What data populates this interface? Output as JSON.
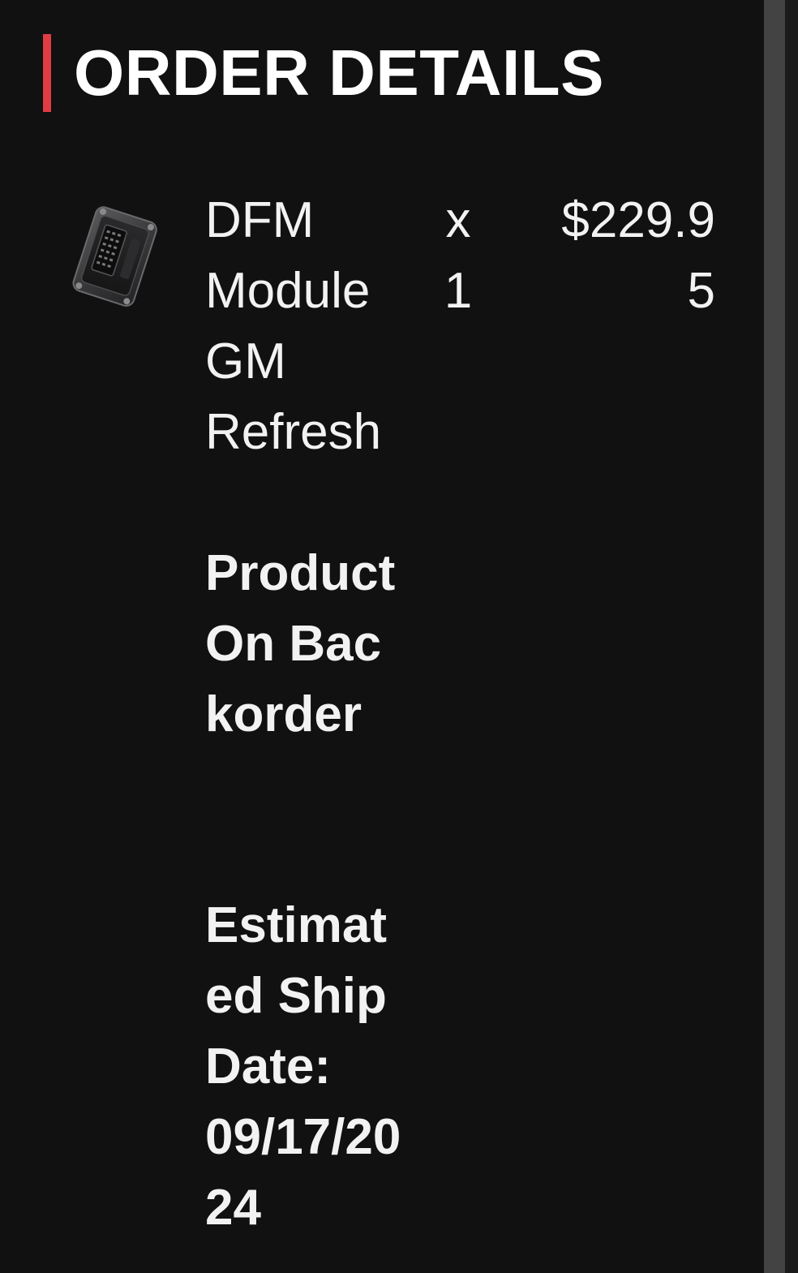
{
  "header": {
    "title": "ORDER DETAILS",
    "accent_color": "#e03c44"
  },
  "order_item": {
    "image_icon": "dfm-module-product-image",
    "name": "DFM Module GM Refresh",
    "quantity": "x 1",
    "price": "$229.95",
    "status": "Product On Backorder",
    "ship_date_label": "Estimated Ship Date:",
    "ship_date_value": "09/17/2024"
  }
}
